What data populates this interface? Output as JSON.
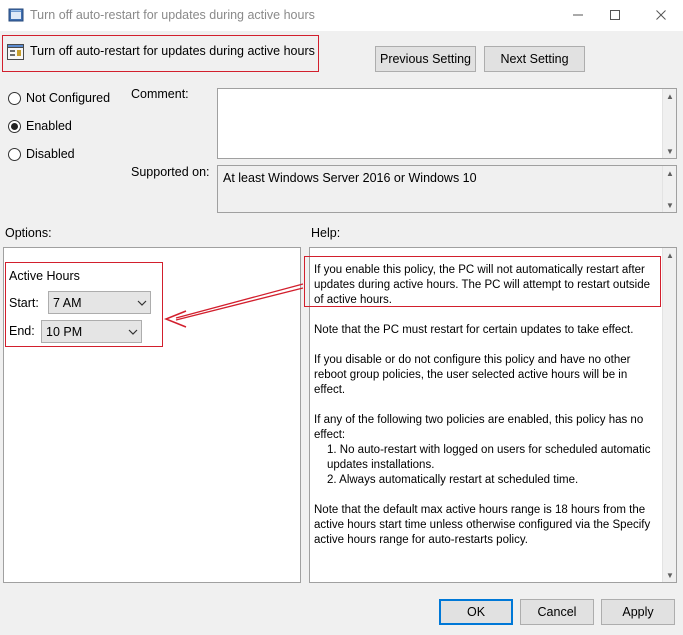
{
  "window": {
    "title": "Turn off auto-restart for updates during active hours",
    "controls": {
      "minimize_icon": "minimize-icon",
      "maximize_icon": "maximize-icon",
      "close_icon": "close-icon"
    }
  },
  "header": {
    "policy_title": "Turn off auto-restart for updates during active hours",
    "prev_label": "Previous Setting",
    "next_label": "Next Setting"
  },
  "state": {
    "options": [
      {
        "label": "Not Configured",
        "selected": false
      },
      {
        "label": "Enabled",
        "selected": true
      },
      {
        "label": "Disabled",
        "selected": false
      }
    ]
  },
  "comment": {
    "label": "Comment:",
    "value": ""
  },
  "supported": {
    "label": "Supported on:",
    "value": "At least Windows Server 2016 or Windows 10"
  },
  "options_panel": {
    "label": "Options:",
    "group_title": "Active Hours",
    "start_label": "Start:",
    "start_value": "7 AM",
    "end_label": "End:",
    "end_value": "10 PM"
  },
  "help": {
    "label": "Help:",
    "p1": "If you enable this policy, the PC will not automatically restart after updates during active hours. The PC will attempt to restart outside of active hours.",
    "p2": "Note that the PC must restart for certain updates to take effect.",
    "p3": "If you disable or do not configure this policy and have no other reboot group policies, the user selected active hours will be in effect.",
    "p4_intro": "If any of the following two policies are enabled, this policy has no effect:",
    "p4_item1": "1. No auto-restart with logged on users for scheduled automatic updates installations.",
    "p4_item2": "2. Always automatically restart at scheduled time.",
    "p5": "Note that the default max active hours range is 18 hours from the active hours start time unless otherwise configured via the Specify active hours range for auto-restarts policy."
  },
  "footer": {
    "ok_label": "OK",
    "cancel_label": "Cancel",
    "apply_label": "Apply"
  },
  "colors": {
    "annotation": "#d21f2d",
    "accent": "#0078d7",
    "window_bg": "#f0f0f0"
  }
}
